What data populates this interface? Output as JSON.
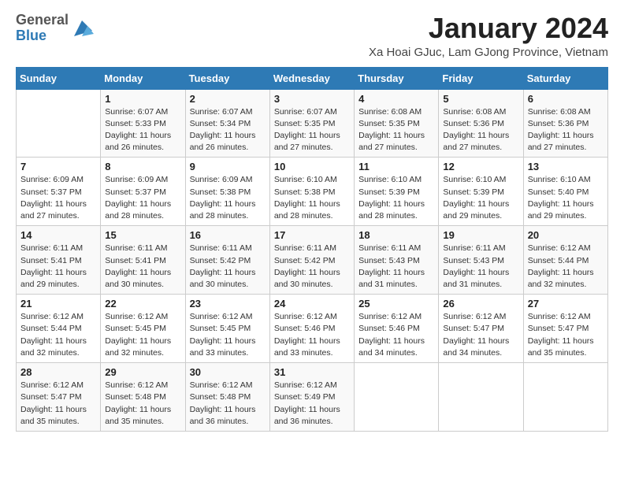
{
  "header": {
    "logo_general": "General",
    "logo_blue": "Blue",
    "title": "January 2024",
    "subtitle": "Xa Hoai GJuc, Lam GJong Province, Vietnam"
  },
  "weekdays": [
    "Sunday",
    "Monday",
    "Tuesday",
    "Wednesday",
    "Thursday",
    "Friday",
    "Saturday"
  ],
  "weeks": [
    [
      {
        "day": "",
        "info": ""
      },
      {
        "day": "1",
        "info": "Sunrise: 6:07 AM\nSunset: 5:33 PM\nDaylight: 11 hours\nand 26 minutes."
      },
      {
        "day": "2",
        "info": "Sunrise: 6:07 AM\nSunset: 5:34 PM\nDaylight: 11 hours\nand 26 minutes."
      },
      {
        "day": "3",
        "info": "Sunrise: 6:07 AM\nSunset: 5:35 PM\nDaylight: 11 hours\nand 27 minutes."
      },
      {
        "day": "4",
        "info": "Sunrise: 6:08 AM\nSunset: 5:35 PM\nDaylight: 11 hours\nand 27 minutes."
      },
      {
        "day": "5",
        "info": "Sunrise: 6:08 AM\nSunset: 5:36 PM\nDaylight: 11 hours\nand 27 minutes."
      },
      {
        "day": "6",
        "info": "Sunrise: 6:08 AM\nSunset: 5:36 PM\nDaylight: 11 hours\nand 27 minutes."
      }
    ],
    [
      {
        "day": "7",
        "info": "Sunrise: 6:09 AM\nSunset: 5:37 PM\nDaylight: 11 hours\nand 27 minutes."
      },
      {
        "day": "8",
        "info": "Sunrise: 6:09 AM\nSunset: 5:37 PM\nDaylight: 11 hours\nand 28 minutes."
      },
      {
        "day": "9",
        "info": "Sunrise: 6:09 AM\nSunset: 5:38 PM\nDaylight: 11 hours\nand 28 minutes."
      },
      {
        "day": "10",
        "info": "Sunrise: 6:10 AM\nSunset: 5:38 PM\nDaylight: 11 hours\nand 28 minutes."
      },
      {
        "day": "11",
        "info": "Sunrise: 6:10 AM\nSunset: 5:39 PM\nDaylight: 11 hours\nand 28 minutes."
      },
      {
        "day": "12",
        "info": "Sunrise: 6:10 AM\nSunset: 5:39 PM\nDaylight: 11 hours\nand 29 minutes."
      },
      {
        "day": "13",
        "info": "Sunrise: 6:10 AM\nSunset: 5:40 PM\nDaylight: 11 hours\nand 29 minutes."
      }
    ],
    [
      {
        "day": "14",
        "info": "Sunrise: 6:11 AM\nSunset: 5:41 PM\nDaylight: 11 hours\nand 29 minutes."
      },
      {
        "day": "15",
        "info": "Sunrise: 6:11 AM\nSunset: 5:41 PM\nDaylight: 11 hours\nand 30 minutes."
      },
      {
        "day": "16",
        "info": "Sunrise: 6:11 AM\nSunset: 5:42 PM\nDaylight: 11 hours\nand 30 minutes."
      },
      {
        "day": "17",
        "info": "Sunrise: 6:11 AM\nSunset: 5:42 PM\nDaylight: 11 hours\nand 30 minutes."
      },
      {
        "day": "18",
        "info": "Sunrise: 6:11 AM\nSunset: 5:43 PM\nDaylight: 11 hours\nand 31 minutes."
      },
      {
        "day": "19",
        "info": "Sunrise: 6:11 AM\nSunset: 5:43 PM\nDaylight: 11 hours\nand 31 minutes."
      },
      {
        "day": "20",
        "info": "Sunrise: 6:12 AM\nSunset: 5:44 PM\nDaylight: 11 hours\nand 32 minutes."
      }
    ],
    [
      {
        "day": "21",
        "info": "Sunrise: 6:12 AM\nSunset: 5:44 PM\nDaylight: 11 hours\nand 32 minutes."
      },
      {
        "day": "22",
        "info": "Sunrise: 6:12 AM\nSunset: 5:45 PM\nDaylight: 11 hours\nand 32 minutes."
      },
      {
        "day": "23",
        "info": "Sunrise: 6:12 AM\nSunset: 5:45 PM\nDaylight: 11 hours\nand 33 minutes."
      },
      {
        "day": "24",
        "info": "Sunrise: 6:12 AM\nSunset: 5:46 PM\nDaylight: 11 hours\nand 33 minutes."
      },
      {
        "day": "25",
        "info": "Sunrise: 6:12 AM\nSunset: 5:46 PM\nDaylight: 11 hours\nand 34 minutes."
      },
      {
        "day": "26",
        "info": "Sunrise: 6:12 AM\nSunset: 5:47 PM\nDaylight: 11 hours\nand 34 minutes."
      },
      {
        "day": "27",
        "info": "Sunrise: 6:12 AM\nSunset: 5:47 PM\nDaylight: 11 hours\nand 35 minutes."
      }
    ],
    [
      {
        "day": "28",
        "info": "Sunrise: 6:12 AM\nSunset: 5:47 PM\nDaylight: 11 hours\nand 35 minutes."
      },
      {
        "day": "29",
        "info": "Sunrise: 6:12 AM\nSunset: 5:48 PM\nDaylight: 11 hours\nand 35 minutes."
      },
      {
        "day": "30",
        "info": "Sunrise: 6:12 AM\nSunset: 5:48 PM\nDaylight: 11 hours\nand 36 minutes."
      },
      {
        "day": "31",
        "info": "Sunrise: 6:12 AM\nSunset: 5:49 PM\nDaylight: 11 hours\nand 36 minutes."
      },
      {
        "day": "",
        "info": ""
      },
      {
        "day": "",
        "info": ""
      },
      {
        "day": "",
        "info": ""
      }
    ]
  ]
}
